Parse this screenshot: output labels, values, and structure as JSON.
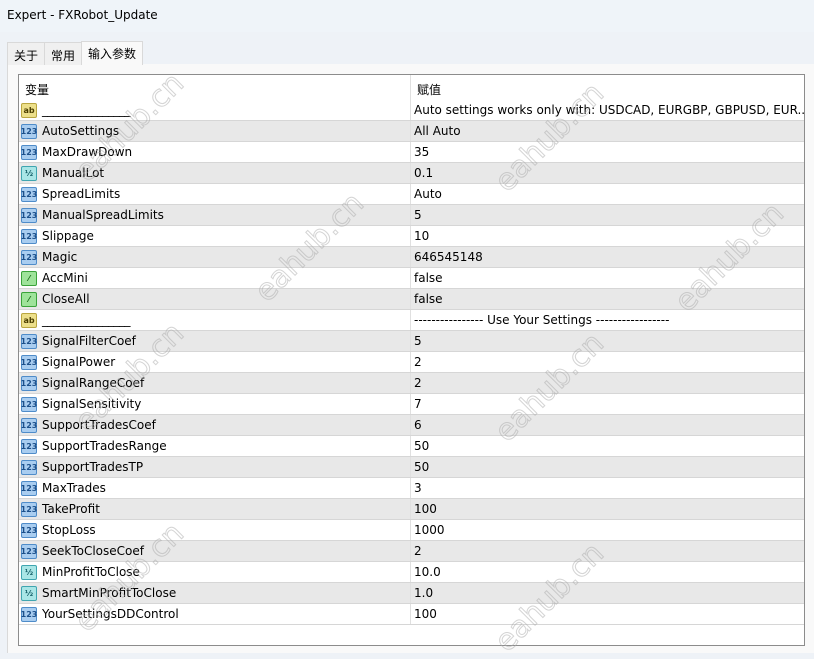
{
  "window": {
    "title": "Expert - FXRobot_Update"
  },
  "tabs": [
    {
      "label": "关于"
    },
    {
      "label": "常用"
    },
    {
      "label": "输入参数",
      "active": true
    }
  ],
  "table": {
    "headers": {
      "variable": "变量",
      "value": "赋值"
    },
    "rows": [
      {
        "icon": "ab",
        "name": "________________",
        "value": "Auto settings works only with: USDCAD, EURGBP, GBPUSD, EUR..."
      },
      {
        "icon": "123",
        "name": "AutoSettings",
        "value": "All Auto"
      },
      {
        "icon": "123",
        "name": "MaxDrawDown",
        "value": "35"
      },
      {
        "icon": "1/2",
        "name": "ManualLot",
        "value": "0.1"
      },
      {
        "icon": "123",
        "name": "SpreadLimits",
        "value": "Auto"
      },
      {
        "icon": "123",
        "name": "ManualSpreadLimits",
        "value": "5"
      },
      {
        "icon": "123",
        "name": "Slippage",
        "value": "10"
      },
      {
        "icon": "123",
        "name": "Magic",
        "value": "646545148"
      },
      {
        "icon": "bool",
        "name": "AccMini",
        "value": "false"
      },
      {
        "icon": "bool",
        "name": "CloseAll",
        "value": "false"
      },
      {
        "icon": "ab",
        "name": "________________",
        "value": "----------------  Use Your Settings -----------------"
      },
      {
        "icon": "123",
        "name": "SignalFilterCoef",
        "value": "5"
      },
      {
        "icon": "123",
        "name": "SignalPower",
        "value": "2"
      },
      {
        "icon": "123",
        "name": "SignalRangeCoef",
        "value": "2"
      },
      {
        "icon": "123",
        "name": "SignalSensitivity",
        "value": "7"
      },
      {
        "icon": "123",
        "name": "SupportTradesCoef",
        "value": "6"
      },
      {
        "icon": "123",
        "name": "SupportTradesRange",
        "value": "50"
      },
      {
        "icon": "123",
        "name": "SupportTradesTP",
        "value": "50"
      },
      {
        "icon": "123",
        "name": "MaxTrades",
        "value": "3"
      },
      {
        "icon": "123",
        "name": "TakeProfit",
        "value": "100"
      },
      {
        "icon": "123",
        "name": "StopLoss",
        "value": "1000"
      },
      {
        "icon": "123",
        "name": "SeekToCloseCoef",
        "value": "2"
      },
      {
        "icon": "1/2",
        "name": "MinProfitToClose",
        "value": "10.0"
      },
      {
        "icon": "1/2",
        "name": "SmartMinProfitToClose",
        "value": "1.0"
      },
      {
        "icon": "123",
        "name": "YourSettingsDDControl",
        "value": "100"
      }
    ]
  },
  "watermark": "eahub.cn"
}
